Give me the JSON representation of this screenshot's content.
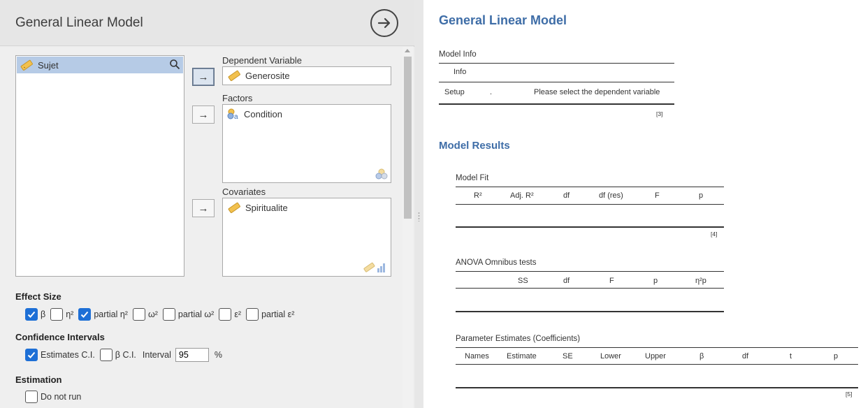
{
  "left_panel": {
    "title": "General Linear Model",
    "variables": [
      {
        "name": "Sujet",
        "type": "ruler"
      }
    ],
    "dependent": {
      "label": "Dependent Variable",
      "value": "Generosite"
    },
    "factors": {
      "label": "Factors",
      "items": [
        "Condition"
      ]
    },
    "covariates": {
      "label": "Covariates",
      "items": [
        "Spiritualite"
      ]
    },
    "effect_size": {
      "title": "Effect Size",
      "options": [
        {
          "label": "β",
          "checked": true
        },
        {
          "label": "η²",
          "checked": false
        },
        {
          "label": "partial η²",
          "checked": true
        },
        {
          "label": "ω²",
          "checked": false
        },
        {
          "label": "partial ω²",
          "checked": false
        },
        {
          "label": "ε²",
          "checked": false
        },
        {
          "label": "partial ε²",
          "checked": false
        }
      ]
    },
    "confidence": {
      "title": "Confidence Intervals",
      "estimates_label": "Estimates C.I.",
      "estimates_checked": true,
      "beta_label": "β C.I.",
      "beta_checked": false,
      "interval_label": "Interval",
      "interval_value": "95",
      "percent": "%"
    },
    "estimation": {
      "title": "Estimation",
      "do_not_run_label": "Do not run",
      "do_not_run_checked": false
    }
  },
  "results": {
    "title": "General Linear Model",
    "model_info": {
      "caption": "Model Info",
      "header": "Info",
      "row_label": "Setup",
      "row_dot": ".",
      "row_message": "Please select the dependent variable",
      "footnote": "[3]"
    },
    "model_results_title": "Model Results",
    "model_fit": {
      "caption": "Model Fit",
      "columns": [
        "R²",
        "Adj. R²",
        "df",
        "df (res)",
        "F",
        "p"
      ],
      "footnote": "[4]"
    },
    "anova": {
      "caption": "ANOVA Omnibus tests",
      "columns": [
        "SS",
        "df",
        "F",
        "p",
        "η²p"
      ]
    },
    "params": {
      "caption": "Parameter Estimates (Coefficients)",
      "columns": [
        "Names",
        "Estimate",
        "SE",
        "Lower",
        "Upper",
        "β",
        "df",
        "t",
        "p"
      ],
      "footnote": "[5]"
    }
  },
  "colors": {
    "accent": "#3e6da7",
    "check": "#1d6fd6",
    "selection": "#b6cbe6"
  }
}
